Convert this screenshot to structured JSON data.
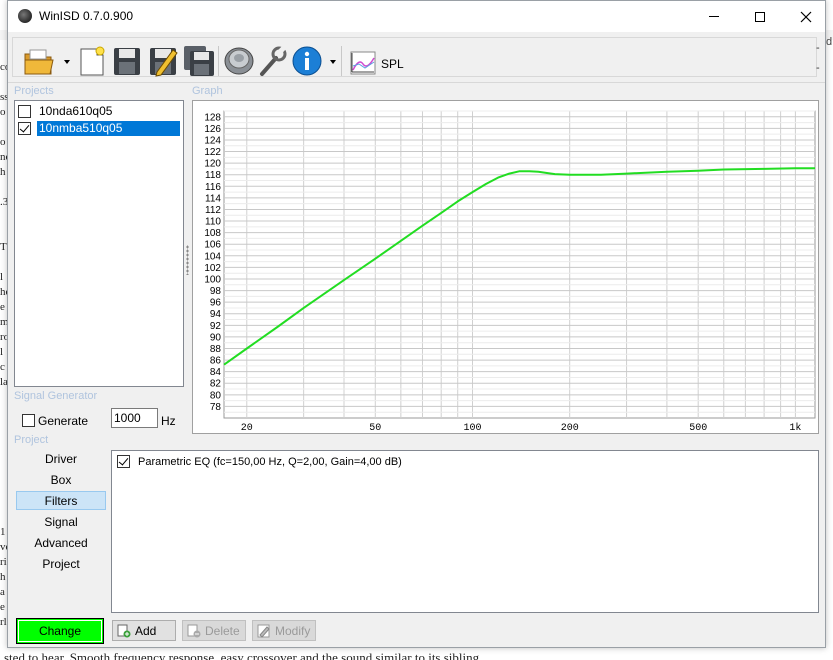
{
  "window": {
    "title": "WinISD 0.7.0.900"
  },
  "toolbar": {
    "spl_label": "SPL",
    "dash_top": "-",
    "dash_bottom": "-",
    "icons": [
      "open-folder-icon",
      "new-document-icon",
      "save-icon",
      "save-as-icon",
      "save-all-icon",
      "driver-icon",
      "settings-wrench-icon",
      "info-icon",
      "spl-chart-icon"
    ]
  },
  "groups": {
    "projects": "Projects",
    "graph": "Graph",
    "signal_generator": "Signal Generator",
    "project": "Project"
  },
  "projects": [
    {
      "label": "10nda610q05",
      "checked": false,
      "selected": false
    },
    {
      "label": "10nmba510q05",
      "checked": true,
      "selected": true
    }
  ],
  "signal_generator": {
    "generate_label": "Generate",
    "generate_checked": false,
    "frequency_value": "1000",
    "unit": "Hz"
  },
  "nav": {
    "items": [
      "Driver",
      "Box",
      "Filters",
      "Signal",
      "Advanced",
      "Project"
    ],
    "active": "Filters"
  },
  "filters": [
    {
      "label": "Parametric EQ (fc=150,00 Hz, Q=2,00, Gain=4,00 dB)",
      "checked": true
    }
  ],
  "buttons": {
    "add": "Add",
    "delete": "Delete",
    "modify": "Modify",
    "change": "Change"
  },
  "background": {
    "left_fragments": [
      "co",
      "",
      "ss",
      "o",
      "",
      "o",
      "ne",
      "h",
      "",
      ".3",
      "",
      "",
      "T",
      "",
      "l",
      "he",
      "e",
      "m",
      "ro",
      "l",
      "c",
      "la",
      "",
      "",
      "",
      "",
      "",
      "",
      "",
      "",
      "",
      "1",
      "ve",
      "ri",
      "h",
      "a",
      "e",
      "rl"
    ],
    "bottom_text": "sted to hear. Smooth frequency response, easy crossover and the sound similar to its sibling.",
    "right_fragment": "d:"
  },
  "chart_data": {
    "type": "line",
    "title": "",
    "xlabel": "",
    "ylabel": "",
    "x_scale": "log",
    "xlim": [
      17,
      1150
    ],
    "ylim": [
      76,
      129
    ],
    "x_ticks": [
      20,
      50,
      100,
      200,
      500,
      1000
    ],
    "x_tick_labels": [
      "20",
      "50",
      "100",
      "200",
      "500",
      "1k"
    ],
    "y_ticks": [
      78,
      80,
      82,
      84,
      86,
      88,
      90,
      92,
      94,
      96,
      98,
      100,
      102,
      104,
      106,
      108,
      110,
      112,
      114,
      116,
      118,
      120,
      122,
      124,
      126,
      128
    ],
    "grid": true,
    "series": [
      {
        "color": "#22dd22",
        "x": [
          17,
          20,
          25,
          30,
          40,
          50,
          60,
          70,
          80,
          90,
          100,
          110,
          120,
          130,
          140,
          150,
          160,
          170,
          180,
          200,
          250,
          300,
          400,
          500,
          600,
          800,
          1000,
          1150
        ],
        "y": [
          85.2,
          88.0,
          91.8,
          95.0,
          99.8,
          103.5,
          106.6,
          109.2,
          111.4,
          113.4,
          115.0,
          116.4,
          117.5,
          118.2,
          118.6,
          118.6,
          118.5,
          118.3,
          118.1,
          118.0,
          118.0,
          118.2,
          118.5,
          118.7,
          118.9,
          119.0,
          119.1,
          119.1
        ]
      }
    ]
  }
}
